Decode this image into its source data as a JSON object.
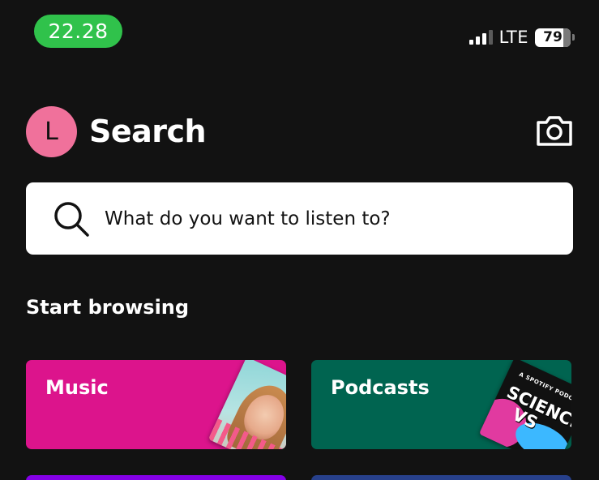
{
  "status_bar": {
    "time": "22.28",
    "network": "LTE",
    "battery": "79",
    "battery_level_percent": 79
  },
  "header": {
    "avatar_initial": "L",
    "title": "Search",
    "camera_icon": "camera-icon"
  },
  "search": {
    "placeholder": "What do you want to listen to?",
    "icon": "search-icon"
  },
  "browse": {
    "section_title": "Start browsing",
    "cards": [
      {
        "label": "Music",
        "color": "#dc148c"
      },
      {
        "label": "Podcasts",
        "color": "#006450"
      },
      {
        "label": "",
        "color": "#8400e7"
      },
      {
        "label": "",
        "color": "#27408b"
      }
    ],
    "podcast_art_text": {
      "kicker": "A SPOTIFY PODCAST",
      "title_line1": "SCIENCE",
      "title_line2": "VS"
    }
  },
  "colors": {
    "background": "#121212",
    "time_pill": "#30c24b",
    "avatar": "#f0719b"
  }
}
